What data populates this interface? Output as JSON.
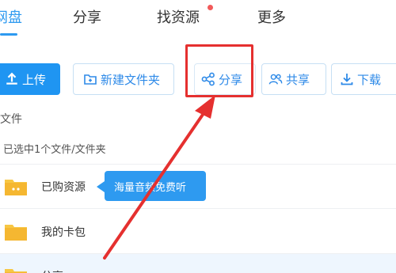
{
  "nav": {
    "tabs": [
      {
        "label": "网盘",
        "active": true
      },
      {
        "label": "分享",
        "active": false
      },
      {
        "label": "找资源",
        "active": false,
        "badge": "red-dot"
      },
      {
        "label": "更多",
        "active": false
      }
    ]
  },
  "toolbar": {
    "upload_label": "上传",
    "new_folder_label": "新建文件夹",
    "share_label": "分享",
    "co_share_label": "共享",
    "download_label": "下载"
  },
  "list": {
    "section_label": "文件",
    "selected_text": "已选中1个文件/文件夹",
    "items": [
      {
        "name": "已购资源",
        "icon": "purchased-folder-icon"
      },
      {
        "name": "我的卡包",
        "icon": "folder-icon"
      },
      {
        "name": "分享",
        "icon": "folder-icon"
      }
    ]
  },
  "tooltip": {
    "text": "海量音频免费听"
  },
  "colors": {
    "accent": "#2e9af0",
    "annotation": "#e5302f",
    "folder": "#f7c744"
  }
}
